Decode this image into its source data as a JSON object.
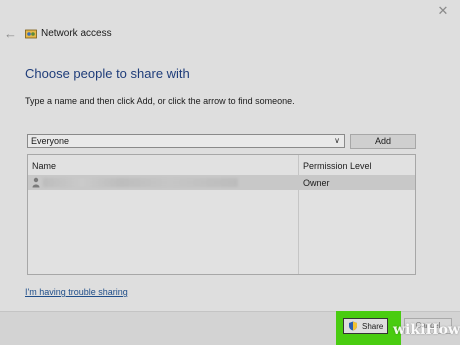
{
  "window": {
    "title": "Network access",
    "close_glyph": "✕",
    "back_glyph": "←"
  },
  "main": {
    "heading": "Choose people to share with",
    "instruction": "Type a name and then click Add, or click the arrow to find someone."
  },
  "name_input": {
    "value": "Everyone",
    "dropdown_glyph": "∨"
  },
  "add_button": {
    "label": "Add"
  },
  "table": {
    "columns": [
      "Name",
      "Permission Level"
    ],
    "rows": [
      {
        "name_redacted": true,
        "permission": "Owner"
      }
    ]
  },
  "trouble_link": {
    "label": "I'm having trouble sharing"
  },
  "footer": {
    "share_label": "Share",
    "cancel_label": "Cancel"
  },
  "watermark": {
    "text": "wikiHow"
  },
  "colors": {
    "accent_highlight": "#49cc10",
    "heading": "#1f3d7a",
    "link": "#1f4e8a"
  }
}
